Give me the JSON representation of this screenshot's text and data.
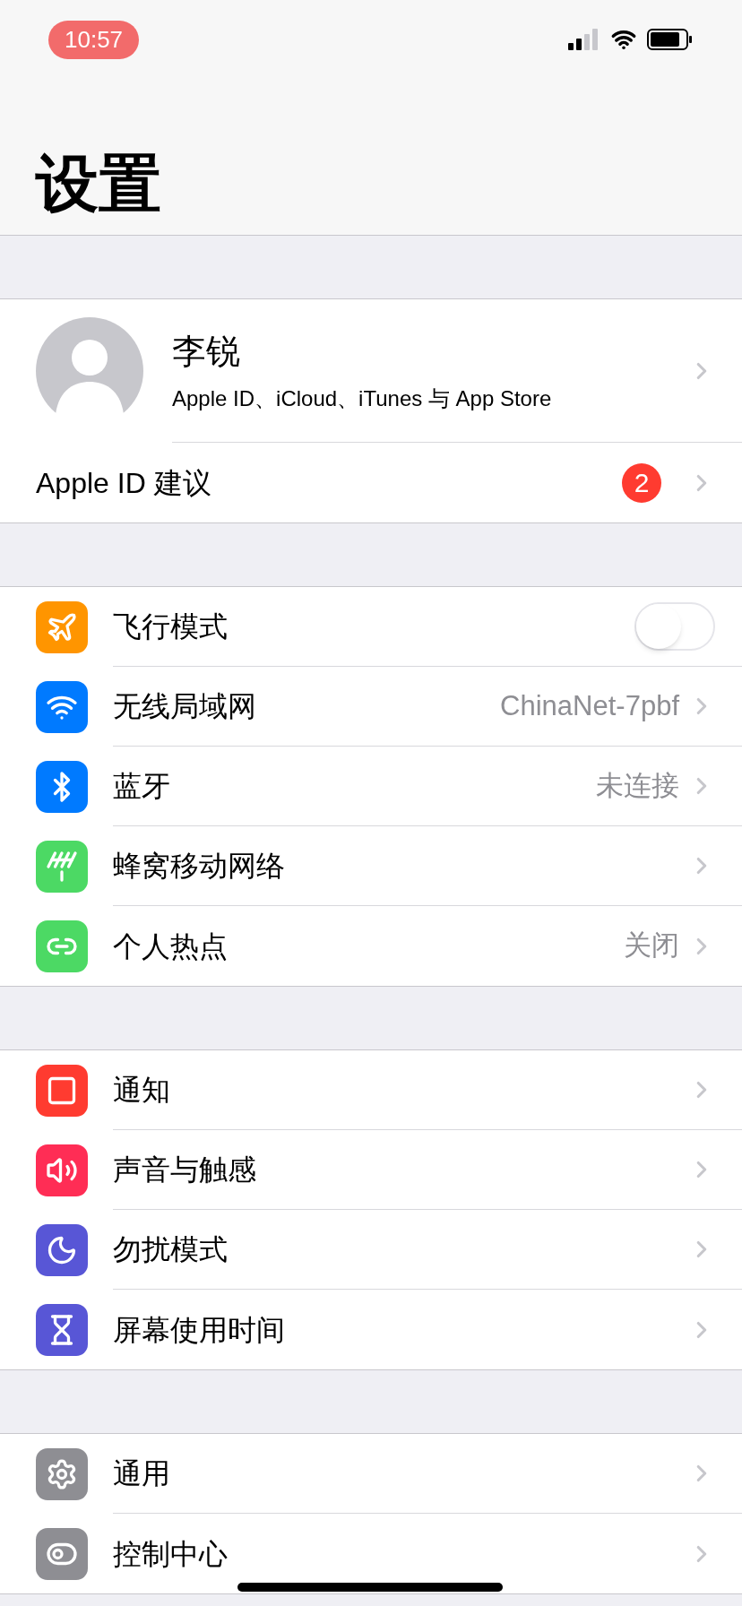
{
  "status_bar": {
    "time": "10:57"
  },
  "title": "设置",
  "profile": {
    "name": "李锐",
    "subtitle": "Apple ID、iCloud、iTunes 与 App Store"
  },
  "suggestion": {
    "label": "Apple ID 建议",
    "badge": "2"
  },
  "groups": [
    [
      {
        "kind": "toggle",
        "label": "飞行模式",
        "on": false,
        "color": "#ff9500"
      },
      {
        "kind": "link",
        "label": "无线局域网",
        "value": "ChinaNet-7pbf",
        "color": "#007aff"
      },
      {
        "kind": "link",
        "label": "蓝牙",
        "value": "未连接",
        "color": "#007aff"
      },
      {
        "kind": "link",
        "label": "蜂窝移动网络",
        "color": "#4cd964"
      },
      {
        "kind": "link",
        "label": "个人热点",
        "value": "关闭",
        "color": "#4cd964"
      }
    ],
    [
      {
        "kind": "link",
        "label": "通知",
        "color": "#ff3b30"
      },
      {
        "kind": "link",
        "label": "声音与触感",
        "color": "#ff2d55"
      },
      {
        "kind": "link",
        "label": "勿扰模式",
        "color": "#5856d6"
      },
      {
        "kind": "link",
        "label": "屏幕使用时间",
        "color": "#5856d6"
      }
    ],
    [
      {
        "kind": "link",
        "label": "通用",
        "color": "#8e8e93"
      },
      {
        "kind": "link",
        "label": "控制中心",
        "color": "#8e8e93"
      }
    ]
  ]
}
